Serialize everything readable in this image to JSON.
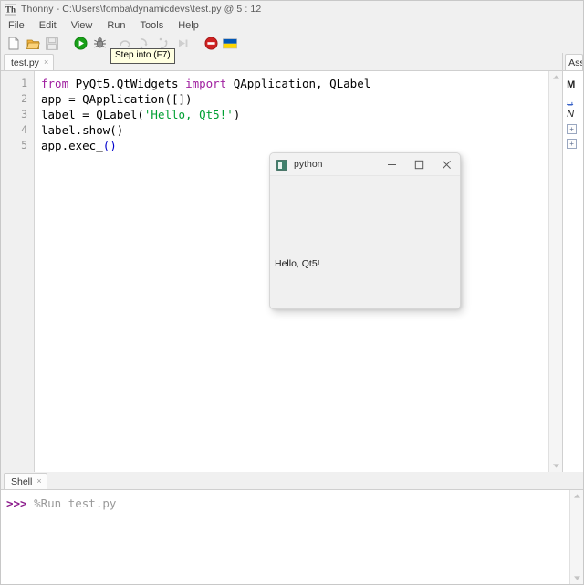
{
  "window": {
    "app_name": "Thonny",
    "separator": "-",
    "file_path": "C:\\Users\\fomba\\dynamicdevs\\test.py",
    "position": "@  5 : 12",
    "title_full": "Thonny  -  C:\\Users\\fomba\\dynamicdevs\\test.py  @  5 : 12",
    "logo_icon": "thonny-logo-icon"
  },
  "menubar": {
    "items": [
      {
        "label": "File"
      },
      {
        "label": "Edit"
      },
      {
        "label": "View"
      },
      {
        "label": "Run"
      },
      {
        "label": "Tools"
      },
      {
        "label": "Help"
      }
    ]
  },
  "toolbar": {
    "buttons": [
      {
        "name": "new-file-icon",
        "label": "New",
        "enabled": true
      },
      {
        "name": "open-file-icon",
        "label": "Load",
        "enabled": true
      },
      {
        "name": "save-file-icon",
        "label": "Save",
        "enabled": false
      },
      {
        "name": "run-icon",
        "label": "Run current script",
        "enabled": true
      },
      {
        "name": "debug-icon",
        "label": "Debug current script",
        "enabled": true
      },
      {
        "name": "step-over-icon",
        "label": "Step over",
        "enabled": false
      },
      {
        "name": "step-into-icon",
        "label": "Step into",
        "enabled": false
      },
      {
        "name": "step-out-icon",
        "label": "Step out",
        "enabled": false
      },
      {
        "name": "resume-icon",
        "label": "Resume",
        "enabled": false
      },
      {
        "name": "stop-icon",
        "label": "Stop/Restart backend",
        "enabled": true
      },
      {
        "name": "ukraine-flag-icon",
        "label": "Support Ukraine",
        "enabled": true
      }
    ],
    "tooltip": "Step into (F7)"
  },
  "editor": {
    "tab": {
      "label": "test.py",
      "close_glyph": "×"
    },
    "line_numbers": [
      "1",
      "2",
      "3",
      "4",
      "5"
    ],
    "lines": [
      {
        "tokens": [
          {
            "t": "from ",
            "c": "kw"
          },
          {
            "t": "PyQt5.QtWidgets ",
            "c": ""
          },
          {
            "t": "import ",
            "c": "kw"
          },
          {
            "t": "QApplication, QLabel",
            "c": ""
          }
        ]
      },
      {
        "tokens": [
          {
            "t": "app = QApplication([])",
            "c": ""
          }
        ]
      },
      {
        "tokens": [
          {
            "t": "label = QLabel(",
            "c": ""
          },
          {
            "t": "'Hello, Qt5!'",
            "c": "str"
          },
          {
            "t": ")",
            "c": ""
          }
        ]
      },
      {
        "tokens": [
          {
            "t": "label.show()",
            "c": ""
          }
        ]
      },
      {
        "tokens": [
          {
            "t": "app.exec_",
            "c": ""
          },
          {
            "t": "()",
            "c": "br"
          }
        ]
      }
    ],
    "scrollbar": {
      "up_glyph": "▲",
      "down_glyph": "▼"
    }
  },
  "assistant": {
    "tab_label": "Ass",
    "lines": [
      {
        "text": "M",
        "style": "bold"
      },
      {
        "text": "␣",
        "style": "link"
      },
      {
        "text": "N",
        "style": "ital"
      },
      {
        "text": "",
        "style": "expander"
      },
      {
        "text": "",
        "style": "expander"
      }
    ],
    "expander_glyph": "+"
  },
  "shell": {
    "tab": {
      "label": "Shell",
      "close_glyph": "×"
    },
    "prompt": ">>>",
    "command": " %Run test.py"
  },
  "qt_window": {
    "title": "python",
    "icon": "python-app-icon",
    "minimize_glyph": "—",
    "maximize_glyph": "□",
    "close_glyph": "✕",
    "label_text": "Hello, Qt5!"
  },
  "colors": {
    "keyword": "#a020a0",
    "string": "#00a033",
    "bracket": "#0000cc",
    "prompt": "#8b1a8b",
    "magic": "#9a9a9a",
    "run_green": "#1a9e1a",
    "stop_red": "#d02020",
    "flag_blue": "#0057b7",
    "flag_yellow": "#ffd700",
    "chrome": "#f0f0f0"
  }
}
